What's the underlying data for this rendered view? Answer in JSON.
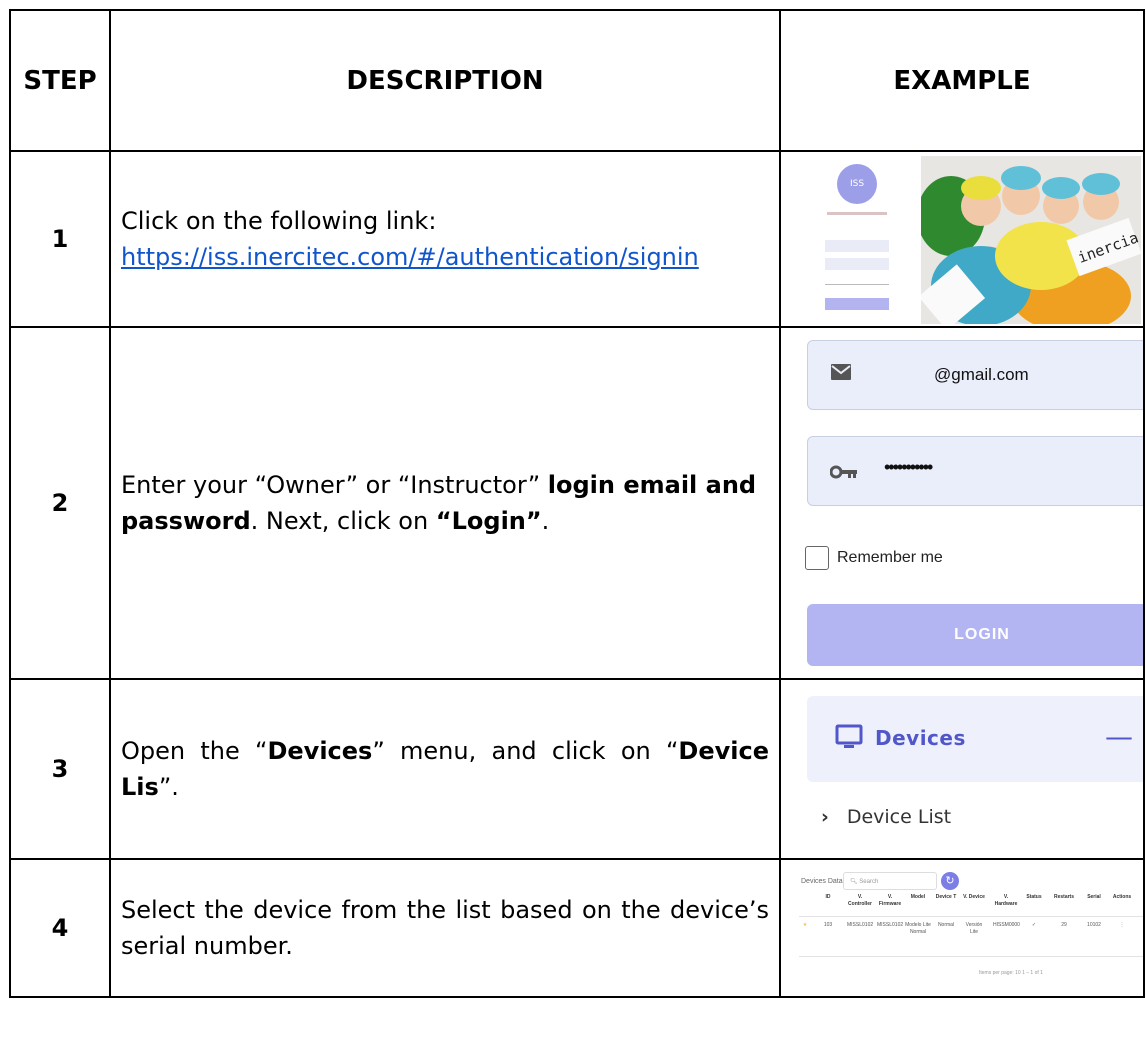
{
  "headers": {
    "step": "STEP",
    "description": "DESCRIPTION",
    "example": "EXAMPLE"
  },
  "rows": [
    {
      "step": "1",
      "text_intro": "Click on the following link:",
      "link": "https://iss.inercitec.com/#/authentication/signin",
      "example": {
        "logo_text": "ISS",
        "photo_text": "inercia i.d.s"
      }
    },
    {
      "step": "2",
      "text_a": "Enter your “Owner” or “Instructor” ",
      "text_bold1": "login email and password",
      "text_b": ". Next, click on ",
      "text_bold2": "“Login”",
      "text_c": ".",
      "example": {
        "email_value": "@gmail.com",
        "password_value": "•••••••••••",
        "remember_label": "Remember me",
        "login_button": "LOGIN"
      }
    },
    {
      "step": "3",
      "text_a": "Open the “",
      "text_bold1": "Devices",
      "text_b": "” menu, and click on “",
      "text_bold2": "Device Lis",
      "text_c": "”.",
      "example": {
        "menu_label": "Devices",
        "collapse_symbol": "—",
        "submenu_label": "Device List"
      }
    },
    {
      "step": "4",
      "text": "Select the device from the list based on the device’s serial number.",
      "example": {
        "table_title": "Devices Data",
        "search_placeholder": "Search",
        "columns": [
          "ID",
          "V. Controller",
          "V. Firmware",
          "Model",
          "Device T",
          "V. Device",
          "V. Hardware",
          "Status",
          "Restarts",
          "Serial",
          "Actions"
        ],
        "row": [
          "103",
          "MISSL0102",
          "MISSL0102",
          "Modelo Lite Normal",
          "Normal",
          "Versión Lite",
          "HISSM0000",
          "✓",
          "29",
          "10102",
          "⋮"
        ],
        "footer": "Items per page: 10   1 – 1 of 1"
      }
    }
  ],
  "colors": {
    "accent": "#5157c9",
    "link": "#1155cc",
    "button": "#b3b5f3",
    "field_bg": "#eaeefb"
  }
}
